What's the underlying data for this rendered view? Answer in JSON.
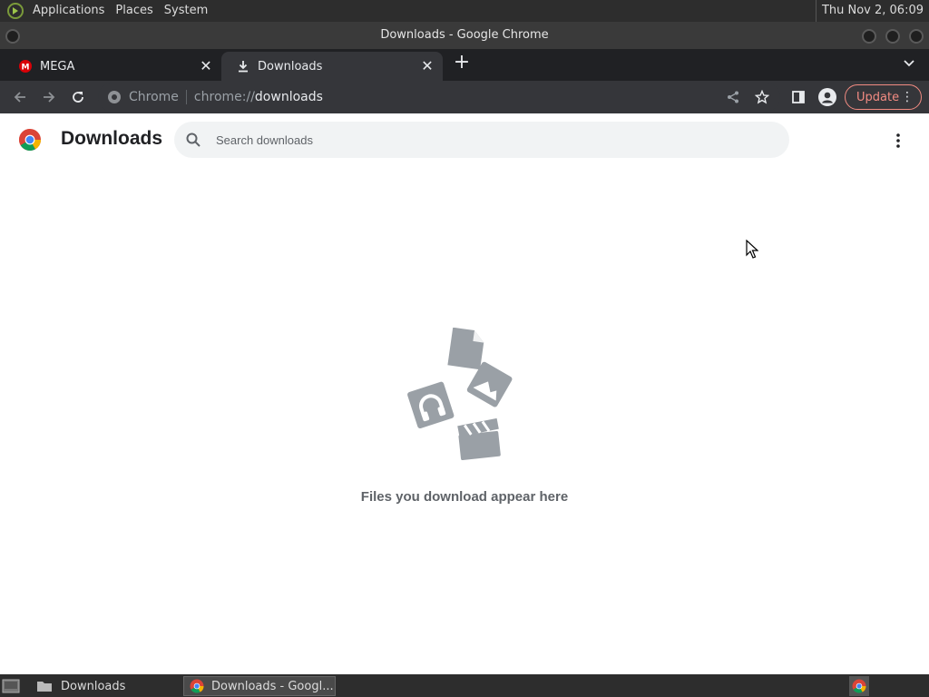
{
  "system_panel": {
    "menus": [
      "Applications",
      "Places",
      "System"
    ],
    "clock": "Thu Nov 2, 06:09"
  },
  "window": {
    "title": "Downloads - Google Chrome"
  },
  "tabs": [
    {
      "label": "MEGA",
      "active": false
    },
    {
      "label": "Downloads",
      "active": true
    }
  ],
  "toolbar": {
    "site_label": "Chrome",
    "url_scheme": "chrome://",
    "url_host": "downloads",
    "update_label": "Update"
  },
  "downloads_page": {
    "title": "Downloads",
    "search_placeholder": "Search downloads",
    "empty_message": "Files you download appear here"
  },
  "taskbar": {
    "items": [
      {
        "label": "Downloads",
        "active": false
      },
      {
        "label": "Downloads - Googl...",
        "active": true
      }
    ]
  },
  "colors": {
    "accent_update": "#f28b82",
    "mega_red": "#d90007",
    "tab_strip": "#202124",
    "toolbar": "#35363a"
  },
  "icons": {
    "back": "arrow-left-icon",
    "forward": "arrow-right-icon",
    "reload": "reload-icon",
    "share": "share-icon",
    "bookmark": "star-icon",
    "side_panel": "side-panel-icon",
    "profile": "profile-icon",
    "search": "search-icon",
    "more": "more-vert-icon"
  }
}
